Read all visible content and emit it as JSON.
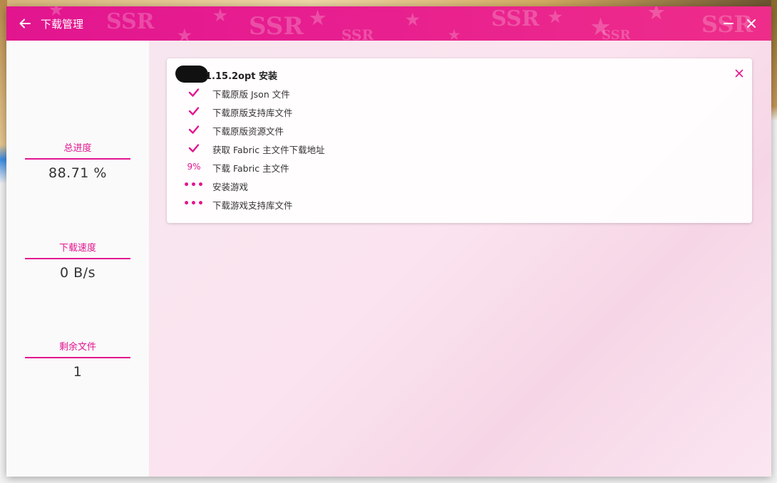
{
  "window": {
    "title": "下载管理",
    "watermark_text": "SSR"
  },
  "colors": {
    "accent": "#e2158f",
    "text": "#333333"
  },
  "sidebar": {
    "stats": [
      {
        "label": "总进度",
        "value": "88.71 %"
      },
      {
        "label": "下载速度",
        "value": "0 B/s"
      },
      {
        "label": "剩余文件",
        "value": "1"
      }
    ]
  },
  "task": {
    "title": "1.15.2opt 安装",
    "steps": [
      {
        "status": "done",
        "icon": "check-icon",
        "label": "下载原版 Json 文件"
      },
      {
        "status": "done",
        "icon": "check-icon",
        "label": "下载原版支持库文件"
      },
      {
        "status": "done",
        "icon": "check-icon",
        "label": "下载原版资源文件"
      },
      {
        "status": "done",
        "icon": "check-icon",
        "label": "获取 Fabric 主文件下载地址"
      },
      {
        "status": "in-progress",
        "progress_text": "9%",
        "label": "下载 Fabric 主文件"
      },
      {
        "status": "pending",
        "icon": "ellipsis-icon",
        "label": "安装游戏"
      },
      {
        "status": "pending",
        "icon": "ellipsis-icon",
        "label": "下载游戏支持库文件"
      }
    ]
  }
}
